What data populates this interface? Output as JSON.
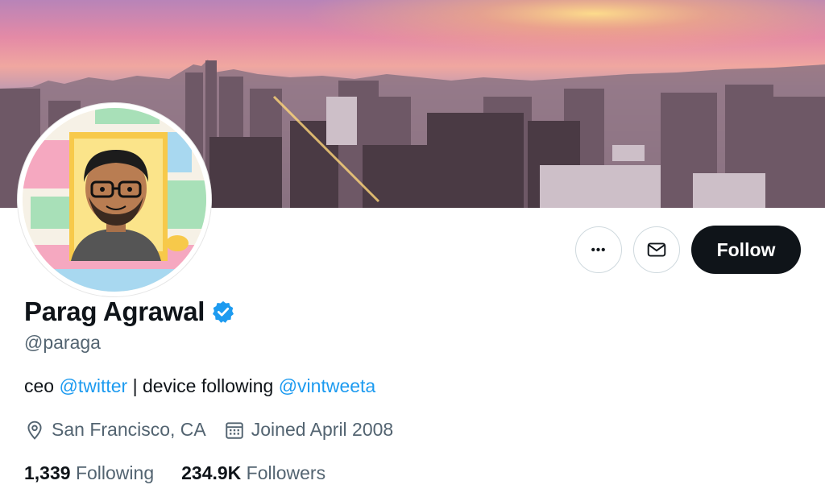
{
  "profile": {
    "name": "Parag Agrawal",
    "handle": "@paraga",
    "verified": true,
    "bio": {
      "prefix": "ceo ",
      "mention1": "@twitter",
      "middle": " | device following ",
      "mention2": "@vintweeta"
    },
    "location": "San Francisco, CA",
    "joined": "Joined April 2008",
    "following_count": "1,339",
    "following_label": "Following",
    "followers_count": "234.9K",
    "followers_label": "Followers"
  },
  "actions": {
    "more_glyph": "•••",
    "follow_label": "Follow"
  },
  "icons": {
    "more": "more-icon",
    "message": "envelope-icon",
    "verified": "verified-badge-icon",
    "location": "location-pin-icon",
    "calendar": "calendar-icon"
  },
  "colors": {
    "accent": "#1d9bf0",
    "text": "#0f1419",
    "secondary": "#536471",
    "follow_bg": "#0f1419"
  }
}
